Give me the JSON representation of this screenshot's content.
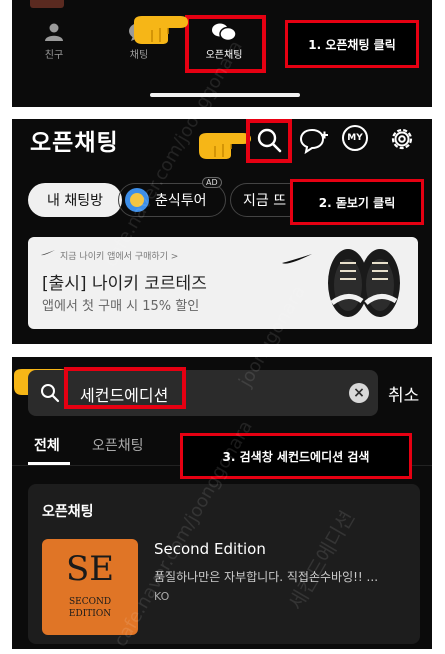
{
  "panel1": {
    "nav": [
      {
        "label": "친구",
        "icon": "person-icon"
      },
      {
        "label": "채팅",
        "icon": "chat-bubble-icon"
      },
      {
        "label": "오픈채팅",
        "icon": "open-chat-icon"
      }
    ],
    "callout": "1. 오픈채팅 클릭"
  },
  "panel2": {
    "title": "오픈채팅",
    "icons": [
      "search-icon",
      "new-chat-icon",
      "my-profile-icon",
      "settings-icon"
    ],
    "my_badge": "MY",
    "chips": [
      "내 채팅방",
      "춘식투어",
      "지금 뜨"
    ],
    "ad_badge": "AD",
    "callout": "2. 돋보기 클릭",
    "banner": {
      "small_text": "지금 나이키 앱에서 구매하기 >",
      "title": "[출시] 나이키 코르테즈",
      "subtitle": "앱에서 첫 구매 시 15% 할인"
    }
  },
  "panel3": {
    "search_value": "세컨드에디션",
    "clear_symbol": "×",
    "cancel_label": "취소",
    "tabs": [
      "전체",
      "오픈채팅"
    ],
    "callout": "3. 검색창 세컨드에디션 검색",
    "result": {
      "section_title": "오픈채팅",
      "logo_mark": "SE",
      "logo_text_1": "SECOND",
      "logo_text_2": "EDITION",
      "name": "Second Edition",
      "description": "품질하나만은 자부합니다. 직접손수바잉!! ...",
      "country": "KO"
    }
  },
  "colors": {
    "panel_bg": "#0b0b0b",
    "highlight_red": "#e60012",
    "pointer_yellow": "#f6b617",
    "thumbnail_orange": "#e07526"
  },
  "watermarks": [
    "cafe.naver.com/joonggonara",
    "세컨드에디션",
    "joonggonara",
    "cafe.naver.com/joonggonara"
  ]
}
